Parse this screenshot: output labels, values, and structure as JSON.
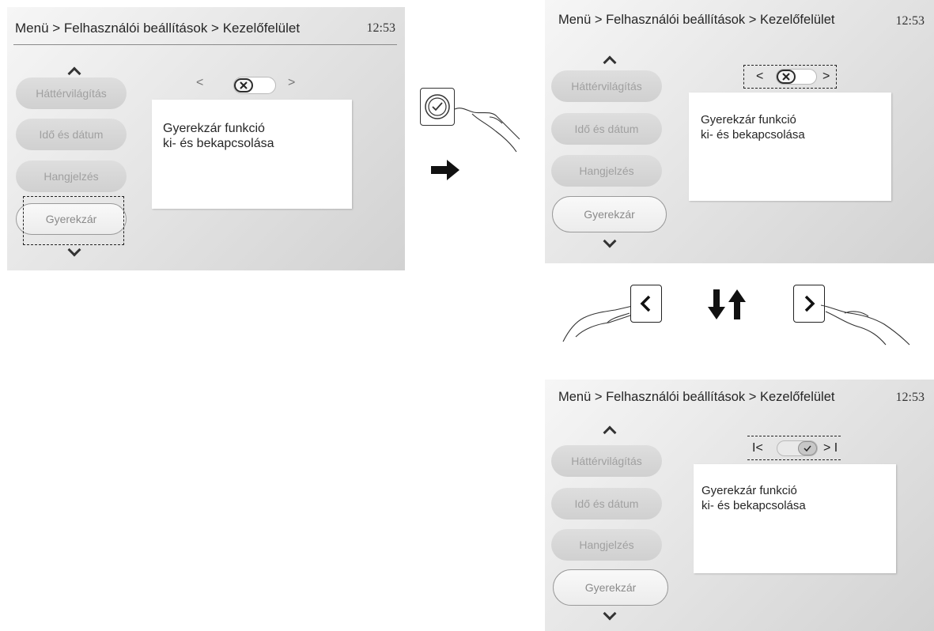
{
  "header": {
    "breadcrumb": "Menü > Felhasználói beállítások > Kezelőfelület",
    "time": "12:53"
  },
  "menu": {
    "items": [
      {
        "label": "Háttérvilágítás",
        "selected": false
      },
      {
        "label": "Idő és dátum",
        "selected": false
      },
      {
        "label": "Hangjelzés",
        "selected": false
      },
      {
        "label": "Gyerekzár",
        "selected": true
      }
    ]
  },
  "description": {
    "line1": "Gyerekzár funkció",
    "line2": "ki- és bekapcsolása"
  },
  "nav": {
    "prev": "<",
    "next": ">"
  },
  "states": [
    {
      "toggle": "off"
    },
    {
      "toggle": "off"
    },
    {
      "toggle": "on"
    }
  ],
  "icons": [
    "chevron-up-icon",
    "chevron-down-icon",
    "x-icon",
    "check-icon",
    "ok-button-icon",
    "arrow-right-icon",
    "arrow-down-icon",
    "arrow-up-icon",
    "hand-icon",
    "left-button-icon",
    "right-button-icon"
  ],
  "colors": {
    "screen_light": "#f6f6f6",
    "screen_dark": "#d2d2d2",
    "text": "#262626",
    "dashed_outline": "#222222"
  }
}
